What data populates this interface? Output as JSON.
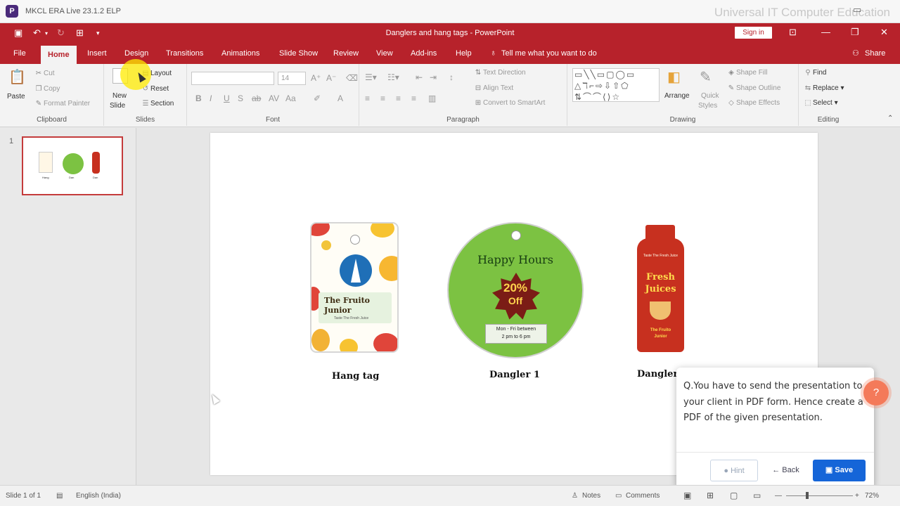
{
  "app": {
    "outer_title": "MKCL ERA Live 23.1.2 ELP",
    "watermark": "Universal IT Computer Education",
    "logo_letter": "P"
  },
  "ppt": {
    "doc_title": "Danglers and hang tags - PowerPoint",
    "sign_in": "Sign in",
    "tabs": [
      "File",
      "Home",
      "Insert",
      "Design",
      "Transitions",
      "Animations",
      "Slide Show",
      "Review",
      "View",
      "Add-ins",
      "Help"
    ],
    "active_tab": "Home",
    "tell_me": "Tell me what you want to do",
    "share": "Share"
  },
  "ribbon": {
    "clipboard": {
      "label": "Clipboard",
      "paste": "Paste",
      "cut": "Cut",
      "copy": "Copy",
      "format_painter": "Format Painter"
    },
    "slides": {
      "label": "Slides",
      "new_slide": "New",
      "new_slide_2": "Slide",
      "layout": "Layout",
      "reset": "Reset",
      "section": "Section"
    },
    "font": {
      "label": "Font",
      "font_name": "",
      "font_size": "14"
    },
    "paragraph": {
      "label": "Paragraph",
      "text_direction": "Text Direction",
      "align_text": "Align Text",
      "convert_smartart": "Convert to SmartArt"
    },
    "drawing": {
      "label": "Drawing",
      "arrange": "Arrange",
      "quick_styles": "Quick",
      "quick_styles_2": "Styles",
      "shape_fill": "Shape Fill",
      "shape_outline": "Shape Outline",
      "shape_effects": "Shape Effects"
    },
    "editing": {
      "label": "Editing",
      "find": "Find",
      "replace": "Replace",
      "select": "Select"
    }
  },
  "thumbnail": {
    "number": "1",
    "labels": [
      "Hang",
      "Dan",
      "Dan"
    ]
  },
  "slide": {
    "hang_tag": {
      "line1": "The Fruito",
      "line2": "Junior",
      "line3": "Taste The Fresh Juice",
      "caption": "Hang tag"
    },
    "dangler1": {
      "title": "Happy Hours",
      "percent": "20%",
      "off": "Off",
      "line1": "Mon - Fri between",
      "line2": "2 pm to 6 pm",
      "caption": "Dangler 1"
    },
    "dangler2": {
      "top": "Taste The Fresh Juice",
      "title1": "Fresh",
      "title2": "Juices",
      "foot1": "The Fruito",
      "foot2": "Junior",
      "caption": "Dangler"
    }
  },
  "question": {
    "text": "Q.You have to send the presentation to your client in PDF form. Hence create a PDF of the given presentation.",
    "hint": "Hint",
    "back": "Back",
    "save": "Save"
  },
  "status": {
    "slide_info": "Slide 1 of 1",
    "language": "English (India)",
    "notes": "Notes",
    "comments": "Comments",
    "zoom": "72%"
  },
  "colors": {
    "ppt_red": "#b7222b",
    "save_blue": "#1565d8",
    "badge": "#f47a5a"
  }
}
